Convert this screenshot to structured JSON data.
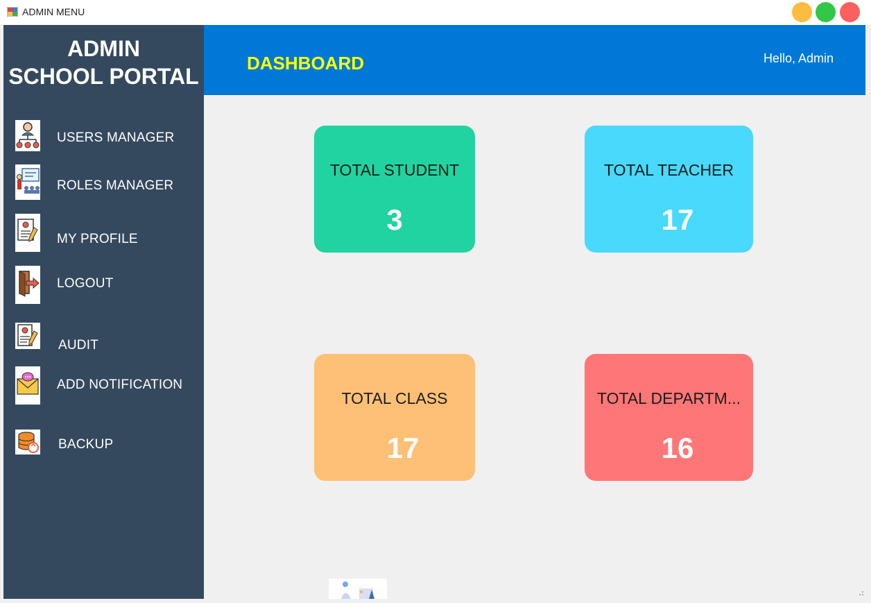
{
  "window": {
    "title": "ADMIN MENU",
    "buttons": {
      "minimize_color": "#fdbc40",
      "maximize_color": "#33c748",
      "close_color": "#fc605c"
    }
  },
  "sidebar": {
    "brand_line1": "ADMIN",
    "brand_line2": "SCHOOL PORTAL",
    "background": "#34495e",
    "items": [
      {
        "label": "USERS MANAGER",
        "icon": "users-hierarchy-icon"
      },
      {
        "label": "ROLES MANAGER",
        "icon": "presentation-icon"
      },
      {
        "label": "MY PROFILE",
        "icon": "profile-document-icon"
      },
      {
        "label": "LOGOUT",
        "icon": "door-exit-icon"
      },
      {
        "label": "AUDIT",
        "icon": "audit-document-icon"
      },
      {
        "label": "ADD NOTIFICATION",
        "icon": "envelope-notification-icon"
      },
      {
        "label": "BACKUP",
        "icon": "database-backup-icon"
      }
    ]
  },
  "header": {
    "title": "DASHBOARD",
    "greeting": "Hello, Admin",
    "background": "#0078d7",
    "title_color": "#ffff00"
  },
  "cards": [
    {
      "label": "TOTAL STUDENT",
      "value": "3",
      "color": "#20d3a0"
    },
    {
      "label": "TOTAL TEACHER",
      "value": "17",
      "color": "#48d9fc"
    },
    {
      "label": "TOTAL CLASS",
      "value": "17",
      "color": "#fec077"
    },
    {
      "label": "TOTAL DEPARTM...",
      "value": "16",
      "color": "#fe7676"
    }
  ]
}
